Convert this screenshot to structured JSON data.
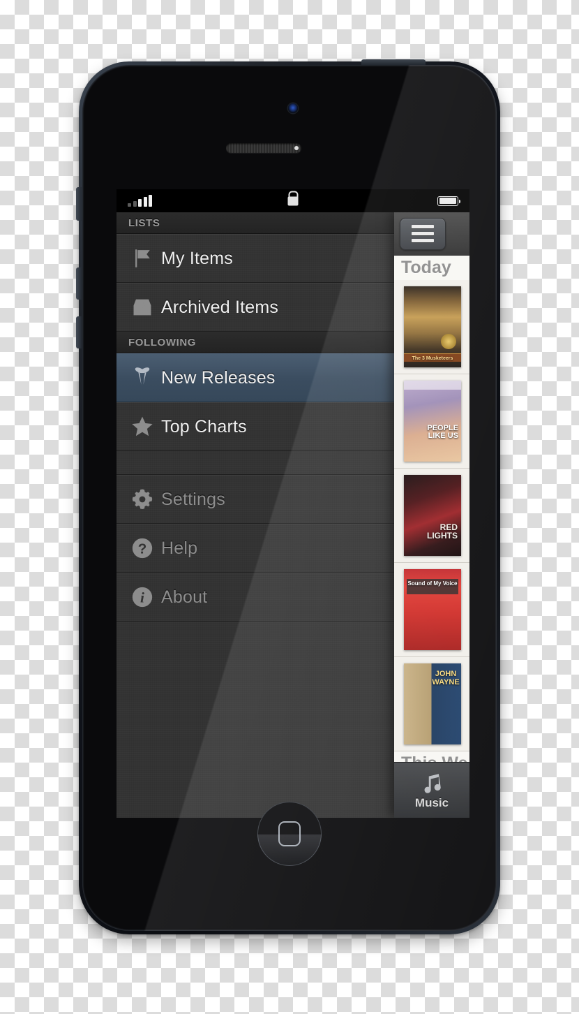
{
  "device": {
    "name": "iphone-5-black",
    "home_button": "home-button",
    "camera": "front-camera",
    "speaker": "earpiece-speaker"
  },
  "statusbar": {
    "signal_icon": "signal-bars-icon",
    "signal_bars_total": 5,
    "signal_bars_active": 3,
    "lock_icon": "lock-icon",
    "battery_icon": "battery-icon",
    "battery_level_pct": 92
  },
  "sidebar": {
    "sections": [
      {
        "header": "LISTS",
        "items": [
          {
            "label": "My Items",
            "icon": "flag-icon",
            "selected": false,
            "dim": false
          },
          {
            "label": "Archived Items",
            "icon": "archive-inbox-icon",
            "selected": false,
            "dim": false
          }
        ]
      },
      {
        "header": "FOLLOWING",
        "items": [
          {
            "label": "New Releases",
            "icon": "crossed-pins-icon",
            "selected": true,
            "dim": false
          },
          {
            "label": "Top Charts",
            "icon": "star-icon",
            "selected": false,
            "dim": false
          }
        ]
      }
    ],
    "utility_items": [
      {
        "label": "Settings",
        "icon": "gear-icon",
        "selected": false,
        "dim": true
      },
      {
        "label": "Help",
        "icon": "question-circle-icon",
        "selected": false,
        "dim": true
      },
      {
        "label": "About",
        "icon": "info-circle-icon",
        "selected": false,
        "dim": true
      }
    ]
  },
  "content_peek": {
    "menu_button_icon": "hamburger-menu-icon",
    "section_today": "Today",
    "section_this_week": "This We",
    "posters": [
      {
        "name": "poster-the-3-musketeers",
        "title": "The 3 Musketeers"
      },
      {
        "name": "poster-people-like-us",
        "title": "PEOPLE LIKE US"
      },
      {
        "name": "poster-red-lights",
        "title": "RED LIGHTS"
      },
      {
        "name": "poster-sound-of-my-voice",
        "title": "Sound of My Voice"
      },
      {
        "name": "poster-john-wayne-double-feature",
        "title": "JOHN WAYNE"
      }
    ],
    "tabbar": {
      "icon": "music-note-icon",
      "label": "Music"
    }
  },
  "colors": {
    "sidebar_bg": "#333333",
    "selected_row": "#3b4d60",
    "section_header_text": "#9a9a9a",
    "row_text": "#f0f0f0",
    "dim_row_text": "#8e8e8e",
    "peek_bg": "#e9e7e2"
  }
}
